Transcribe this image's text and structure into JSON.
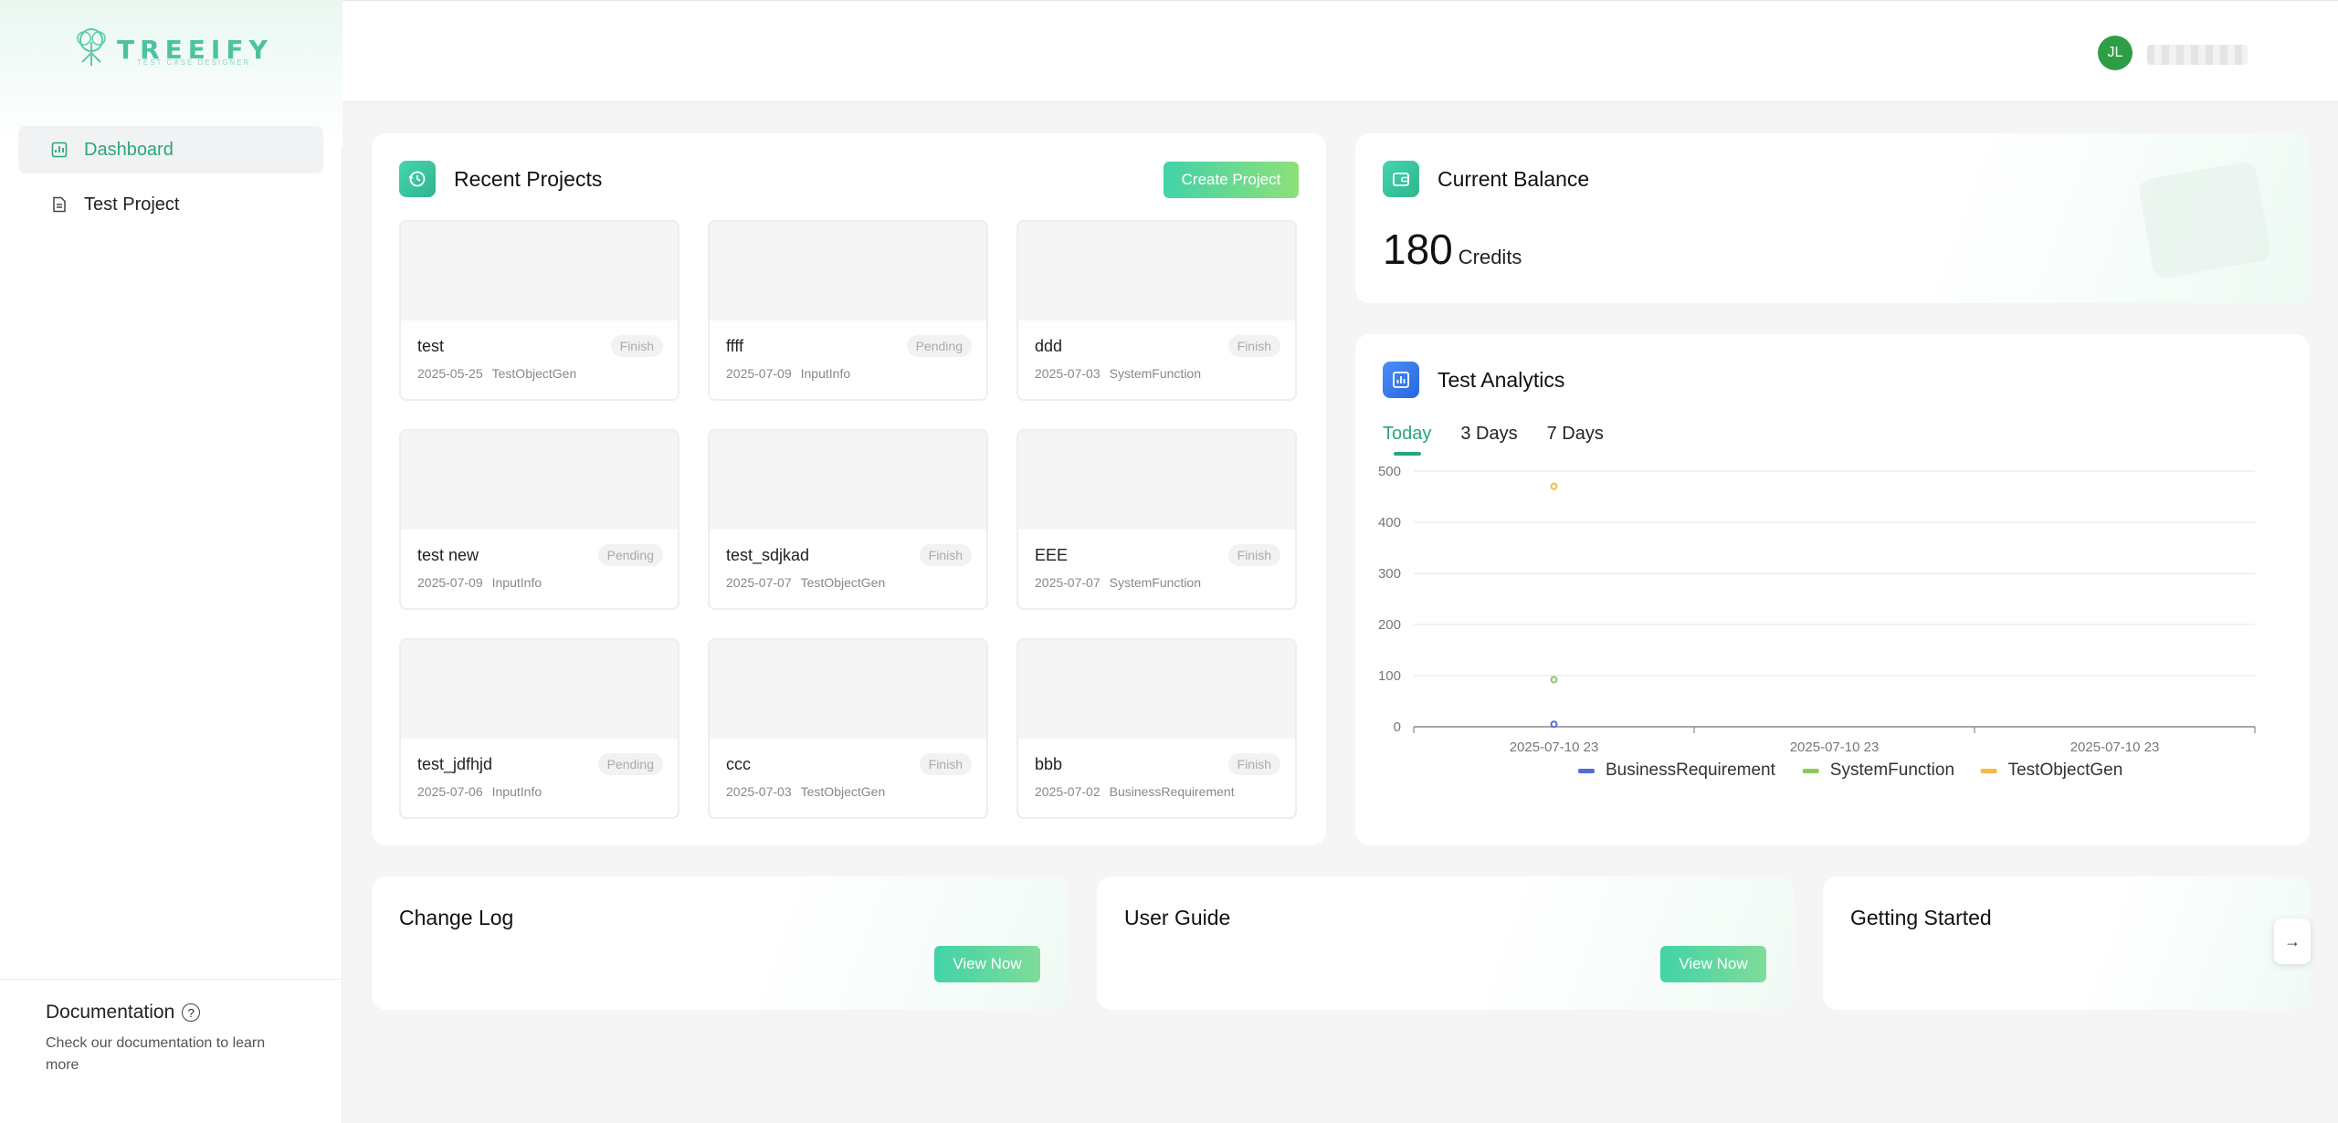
{
  "brand": {
    "logo_text": "TREEIFY",
    "logo_sub": "TEST CASE DESIGNER",
    "accent": "#27a77d"
  },
  "sidebar": {
    "items": [
      {
        "label": "Dashboard",
        "icon": "dashboard-icon",
        "active": true
      },
      {
        "label": "Test Project",
        "icon": "document-icon",
        "active": false
      }
    ],
    "documentation": {
      "title": "Documentation",
      "text": "Check our documentation to learn more"
    }
  },
  "header": {
    "avatar_initials": "JL",
    "username": "user"
  },
  "recent_projects": {
    "title": "Recent Projects",
    "create_label": "Create Project",
    "items": [
      {
        "name": "test",
        "status": "Finish",
        "date": "2025-05-25",
        "type": "TestObjectGen"
      },
      {
        "name": "ffff",
        "status": "Pending",
        "date": "2025-07-09",
        "type": "InputInfo"
      },
      {
        "name": "ddd",
        "status": "Finish",
        "date": "2025-07-03",
        "type": "SystemFunction"
      },
      {
        "name": "test new",
        "status": "Pending",
        "date": "2025-07-09",
        "type": "InputInfo"
      },
      {
        "name": "test_sdjkad",
        "status": "Finish",
        "date": "2025-07-07",
        "type": "TestObjectGen"
      },
      {
        "name": "EEE",
        "status": "Finish",
        "date": "2025-07-07",
        "type": "SystemFunction"
      },
      {
        "name": "test_jdfhjd",
        "status": "Pending",
        "date": "2025-07-06",
        "type": "InputInfo"
      },
      {
        "name": "ccc",
        "status": "Finish",
        "date": "2025-07-03",
        "type": "TestObjectGen"
      },
      {
        "name": "bbb",
        "status": "Finish",
        "date": "2025-07-02",
        "type": "BusinessRequirement"
      }
    ]
  },
  "balance": {
    "title": "Current Balance",
    "value": "180",
    "unit": "Credits"
  },
  "analytics": {
    "title": "Test Analytics",
    "tabs": [
      "Today",
      "3 Days",
      "7 Days"
    ],
    "active_tab": 0
  },
  "chart_data": {
    "type": "scatter",
    "x": [
      "2025-07-10 23"
    ],
    "x_tick_labels": [
      "2025-07-10 23",
      "2025-07-10 23",
      "2025-07-10 23"
    ],
    "ylim": [
      0,
      500
    ],
    "y_ticks": [
      0,
      100,
      200,
      300,
      400,
      500
    ],
    "grid": true,
    "legend": "bottom",
    "series": [
      {
        "name": "BusinessRequirement",
        "values": [
          5
        ],
        "color": "#4e6fd6"
      },
      {
        "name": "SystemFunction",
        "values": [
          92
        ],
        "color": "#8bcb5c"
      },
      {
        "name": "TestObjectGen",
        "values": [
          470
        ],
        "color": "#f7b944"
      }
    ]
  },
  "bottom": {
    "change_log": {
      "title": "Change Log",
      "button": "View Now"
    },
    "user_guide": {
      "title": "User Guide",
      "button": "View Now"
    },
    "getting_started": {
      "title": "Getting Started"
    }
  }
}
